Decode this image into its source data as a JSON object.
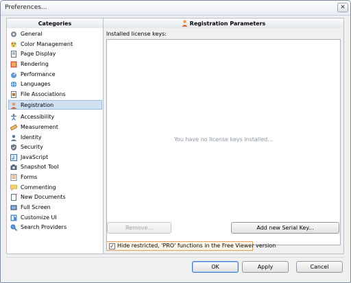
{
  "window": {
    "title": "Preferences..."
  },
  "categories": {
    "header": "Categories",
    "items": [
      {
        "label": "General",
        "icon": "gear-icon",
        "selected": false
      },
      {
        "label": "Color Management",
        "icon": "palette-icon",
        "selected": false
      },
      {
        "label": "Page Display",
        "icon": "page-icon",
        "selected": false
      },
      {
        "label": "Rendering",
        "icon": "rendering-icon",
        "selected": false
      },
      {
        "label": "Performance",
        "icon": "performance-icon",
        "selected": false
      },
      {
        "label": "Languages",
        "icon": "globe-icon",
        "selected": false
      },
      {
        "label": "File Associations",
        "icon": "file-icon",
        "selected": false
      },
      {
        "label": "Registration",
        "icon": "registration-icon",
        "selected": true
      },
      {
        "label": "Accessibility",
        "icon": "accessibility-icon",
        "selected": false
      },
      {
        "label": "Measurement",
        "icon": "ruler-icon",
        "selected": false
      },
      {
        "label": "Identity",
        "icon": "identity-icon",
        "selected": false
      },
      {
        "label": "Security",
        "icon": "shield-icon",
        "selected": false
      },
      {
        "label": "JavaScript",
        "icon": "javascript-icon",
        "selected": false
      },
      {
        "label": "Snapshot Tool",
        "icon": "camera-icon",
        "selected": false
      },
      {
        "label": "Forms",
        "icon": "forms-icon",
        "selected": false
      },
      {
        "label": "Commenting",
        "icon": "comment-icon",
        "selected": false
      },
      {
        "label": "New Documents",
        "icon": "new-document-icon",
        "selected": false
      },
      {
        "label": "Full Screen",
        "icon": "fullscreen-icon",
        "selected": false
      },
      {
        "label": "Customize UI",
        "icon": "customize-icon",
        "selected": false
      },
      {
        "label": "Search Providers",
        "icon": "search-icon",
        "selected": false
      }
    ]
  },
  "registration": {
    "header": "Registration Parameters",
    "installed_label": "Installed license keys:",
    "empty_message": "You have no license keys installed...",
    "remove_label": "Remove...",
    "add_serial_label": "Add new Serial Key...",
    "hide_restricted_label": "Hide restricted, 'PRO' functions in the Free Viewer version",
    "hide_restricted_checked": true
  },
  "footer": {
    "ok_label": "OK",
    "apply_label": "Apply",
    "cancel_label": "Cancel"
  },
  "colors": {
    "selection": "#cfe0f3",
    "accent": "#3d7bd9",
    "highlight_border": "#e8a25a"
  }
}
